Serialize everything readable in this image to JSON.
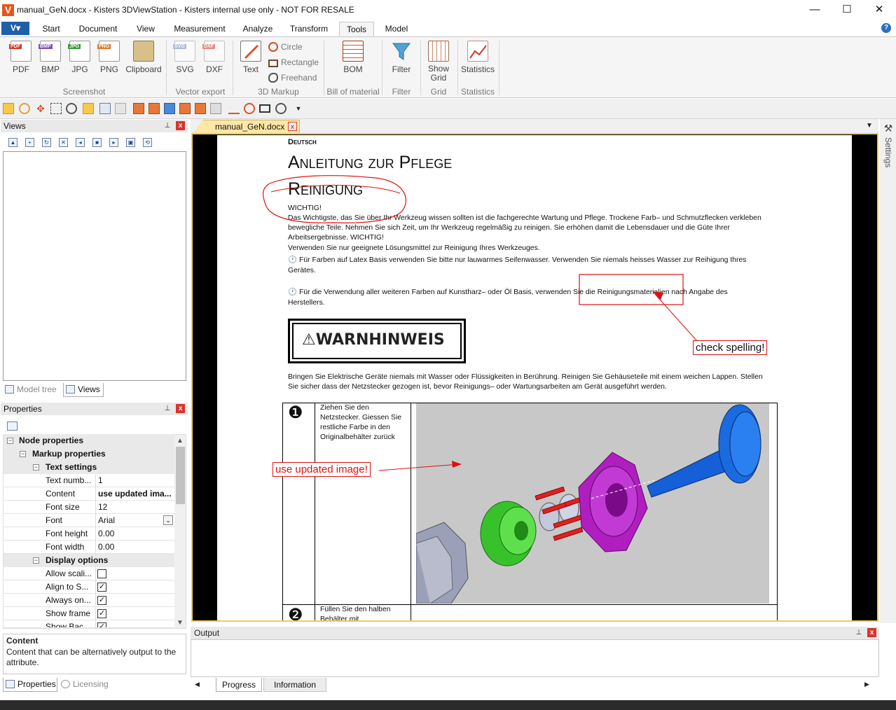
{
  "window": {
    "title": "manual_GeN.docx - Kisters 3DViewStation - Kisters internal use only - NOT FOR RESALE",
    "app_icon_letter": "V",
    "minimize_glyph": "—",
    "maximize_glyph": "☐",
    "close_glyph": "✕"
  },
  "menu": {
    "app_button": "V▾",
    "tabs": [
      "Start",
      "Document",
      "View",
      "Measurement",
      "Analyze",
      "Transform",
      "Tools",
      "Model"
    ],
    "active_tab": "Tools",
    "help_glyph": "?"
  },
  "ribbon": {
    "screenshot": {
      "buttons": [
        "PDF",
        "BMP",
        "JPG",
        "PNG",
        "Clipboard"
      ],
      "group_label": "Screenshot"
    },
    "vector_export": {
      "buttons": [
        "SVG",
        "DXF"
      ],
      "group_label": "Vector export"
    },
    "markup": {
      "text_button": "Text",
      "circle": "Circle",
      "rectangle": "Rectangle",
      "freehand": "Freehand",
      "group_label": "3D Markup"
    },
    "bom": {
      "button": "BOM",
      "group_label": "Bill of material"
    },
    "filter": {
      "button": "Filter",
      "group_label": "Filter"
    },
    "grid": {
      "button_line1": "Show",
      "button_line2": "Grid",
      "group_label": "Grid"
    },
    "statistics": {
      "button": "Statistics",
      "group_label": "Statistics"
    }
  },
  "views_panel": {
    "title": "Views",
    "pin_glyph": "⊥",
    "close_glyph": "x",
    "tabs": [
      "Model tree",
      "Views"
    ],
    "active_tab": "Views"
  },
  "properties_panel": {
    "title": "Properties",
    "groups": {
      "node": "Node properties",
      "markup": "Markup properties",
      "text_settings": "Text settings",
      "display_options": "Display options"
    },
    "text_rows": [
      {
        "label": "Text numb...",
        "value": "1"
      },
      {
        "label": "Content",
        "value": "use updated ima..."
      },
      {
        "label": "Font size",
        "value": "12"
      },
      {
        "label": "Font",
        "value": "Arial"
      },
      {
        "label": "Font height",
        "value": "0.00"
      },
      {
        "label": "Font width",
        "value": "0.00"
      }
    ],
    "display_rows": [
      {
        "label": "Allow scali...",
        "checked": false
      },
      {
        "label": "Align to S...",
        "checked": true
      },
      {
        "label": "Always on...",
        "checked": true
      },
      {
        "label": "Show frame",
        "checked": true
      },
      {
        "label": "Show Bac...",
        "checked": true
      }
    ],
    "check_glyph": "✓",
    "description_title": "Content",
    "description_text": "Content that can be alternatively output to the attribute.",
    "tabs": [
      "Properties",
      "Licensing"
    ]
  },
  "document": {
    "tab_label": "manual_GeN.docx",
    "tab_close": "x",
    "menu_glyph": "▼",
    "lang_header": "Deutsch",
    "title_line1": "Anleitung zur Pflege",
    "title_line2": "Reinigung",
    "paragraphs": [
      "WICHTIG!",
      "Das Wichtigste, das Sie über Ihr Werkzeug wissen sollten ist die fachgerechte Wartung und Pflege. Trockene Farb– und Schmutzflecken verkleben",
      "bewegliche Teile. Nehmen Sie sich Zeit, um Ihr Werkzeug regelmäßig zu reinigen. Sie erhöhen damit die Lebensdauer und die Güte Ihrer",
      "Arbeitsergebnisse. WICHTIG!",
      "Verwenden Sie nur geeignete Lösungsmittel zur Reinigung Ihres Werkzeuges.",
      "Für Farben auf Latex Basis verwenden Sie bitte nur lauwarmes Seifenwasser. Verwenden Sie niemals heisses Wasser zur Reihigung Ihres",
      "Gerätes.",
      "Für die Verwendung aller weiteren Farben auf Kunstharz– oder Öl Basis, verwenden Sie die Reinigungsmaterialien nach Angabe des",
      "Herstellers."
    ],
    "clock_glyph": "🕐",
    "warning_label": "WARNHINWEIS",
    "warning_glyph": "⚠",
    "warning_paragraph_1": "Bringen Sie Elektrische Geräte niemals mit Wasser oder Flüssigkeiten in Berührung. Reinigen Sie Gehäuseteile mit einem weichen Lappen. Stellen",
    "warning_paragraph_2": "Sie sicher dass der Netzstecker gezogen ist, bevor Reinigungs– oder Wartungsarbeiten am Gerät ausgeführt werden.",
    "steps": [
      {
        "number": "❶",
        "text": [
          "Ziehen Sie den",
          "Netzstecker. Giessen Sie",
          "restliche Farbe in den",
          "Originalbehälter zurück"
        ]
      },
      {
        "number": "❷",
        "text": [
          "Füllen Sie den halben",
          "Behälter mit"
        ]
      }
    ],
    "annotations": {
      "spelling": "check spelling!",
      "image": "use updated image!"
    },
    "colors": {
      "markup_red": "#e01010",
      "part_blue": "#1560d8",
      "part_magenta": "#b01ec0",
      "part_green": "#2ec21e",
      "part_red": "#e02020"
    }
  },
  "settings_strip": {
    "label": "Settings"
  },
  "output_panel": {
    "title": "Output",
    "tabs": [
      "Progress",
      "Information"
    ],
    "active_tab": "Progress",
    "nav_left": "◀",
    "nav_right": "▶"
  }
}
